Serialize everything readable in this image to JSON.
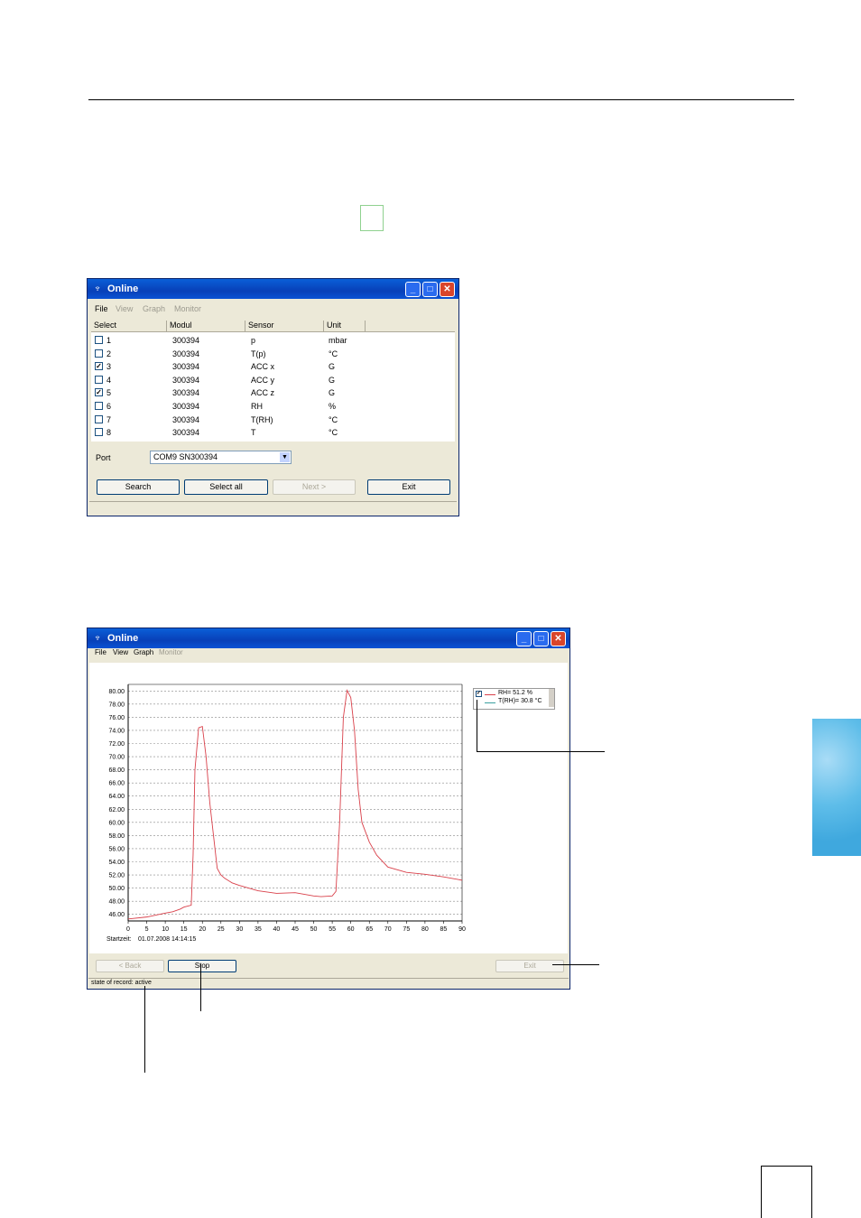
{
  "window1": {
    "title": "Online",
    "menu": [
      "File",
      "View",
      "Graph",
      "Monitor"
    ],
    "columns": [
      "Select",
      "Modul",
      "Sensor",
      "Unit"
    ],
    "rows": [
      {
        "select": "1",
        "checked": false,
        "modul": "300394",
        "sensor": "p",
        "unit": "mbar"
      },
      {
        "select": "2",
        "checked": false,
        "modul": "300394",
        "sensor": "T(p)",
        "unit": "°C"
      },
      {
        "select": "3",
        "checked": true,
        "modul": "300394",
        "sensor": "ACC x",
        "unit": "G"
      },
      {
        "select": "4",
        "checked": false,
        "modul": "300394",
        "sensor": "ACC y",
        "unit": "G"
      },
      {
        "select": "5",
        "checked": true,
        "modul": "300394",
        "sensor": "ACC z",
        "unit": "G"
      },
      {
        "select": "6",
        "checked": false,
        "modul": "300394",
        "sensor": "RH",
        "unit": "%"
      },
      {
        "select": "7",
        "checked": false,
        "modul": "300394",
        "sensor": "T(RH)",
        "unit": "°C"
      },
      {
        "select": "8",
        "checked": false,
        "modul": "300394",
        "sensor": "T",
        "unit": "°C"
      }
    ],
    "port_label": "Port",
    "port_value": "COM9  SN300394",
    "buttons": {
      "search": "Search",
      "select_all": "Select all",
      "next": "Next >",
      "exit": "Exit"
    }
  },
  "window2": {
    "title": "Online",
    "menu": [
      "File",
      "View",
      "Graph",
      "Monitor"
    ],
    "legend": [
      {
        "label": "RH= 51.2 %",
        "checked": true,
        "color": "#d9404a"
      },
      {
        "label": "T(RH)= 30.8 °C",
        "checked": false,
        "color": "#3aa0a0"
      }
    ],
    "startzeit_label": "Startzeit:",
    "startzeit_value": "01.07.2008 14:14:15",
    "buttons": {
      "back": "< Back",
      "stop": "Stop",
      "exit": "Exit"
    },
    "status": "state of record: active"
  },
  "chart_data": {
    "type": "line",
    "xlim": [
      0,
      90
    ],
    "ylim": [
      45,
      81
    ],
    "x_ticks": [
      0,
      5,
      10,
      15,
      20,
      25,
      30,
      35,
      40,
      45,
      50,
      55,
      60,
      65,
      70,
      75,
      80,
      85,
      90
    ],
    "y_ticks": [
      "46.00",
      "48.00",
      "50.00",
      "52.00",
      "54.00",
      "56.00",
      "58.00",
      "60.00",
      "62.00",
      "64.00",
      "66.00",
      "68.00",
      "70.00",
      "72.00",
      "74.00",
      "76.00",
      "78.00",
      "80.00"
    ],
    "series": [
      {
        "name": "RH= 51.2 %",
        "color": "#d9404a",
        "x": [
          0,
          5,
          10,
          12,
          14,
          15,
          17,
          17.5,
          18,
          19,
          20,
          21,
          22,
          23,
          24,
          25,
          26,
          28,
          30,
          35,
          40,
          45,
          50,
          52,
          55,
          56,
          57,
          58,
          59,
          60,
          61,
          62,
          63,
          65,
          67,
          70,
          75,
          80,
          85,
          90
        ],
        "y": [
          45.3,
          45.6,
          46.2,
          46.4,
          46.8,
          47.1,
          47.4,
          55,
          68,
          74.4,
          74.6,
          70,
          63,
          58,
          53,
          52,
          51.5,
          50.8,
          50.4,
          49.6,
          49.2,
          49.3,
          48.8,
          48.7,
          48.8,
          49.5,
          60,
          76,
          80.1,
          79,
          74,
          65,
          60,
          57,
          55,
          53.2,
          52.4,
          52.1,
          51.7,
          51.2
        ]
      }
    ]
  }
}
